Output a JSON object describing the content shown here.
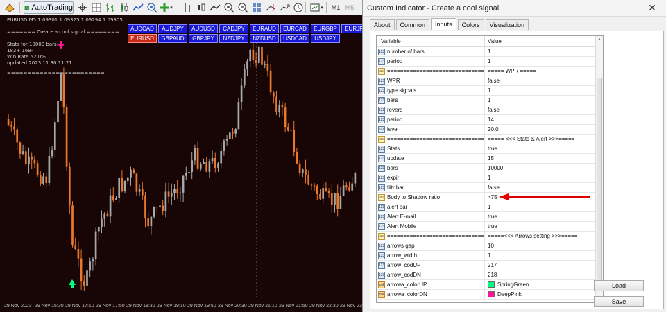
{
  "toolbar": {
    "autotrading_label": "AutoTrading",
    "timeframes": [
      "M1",
      "M5"
    ]
  },
  "chart": {
    "symbol_line": "EURUSD,M5  1.09301 1.09325 1.09294 1.09305",
    "signal_title": "======= Create a cool signal ========",
    "stats_lines": [
      "Stats for 10000 bars:",
      "183+   169-",
      "Win Rate 52.0%",
      "updated 2023.11.30 11:21"
    ],
    "separator_line": "========================",
    "pair_buttons": [
      [
        "AUDCAD",
        "AUDJPY",
        "AUDUSD",
        "CADJPY",
        "EURAUD",
        "EURCAD",
        "EURGBP",
        "EURJPY"
      ],
      [
        "EURUSD",
        "GBPAUD",
        "GBPJPY",
        "NZDJPY",
        "NZDUSD",
        "USDCAD",
        "USDJPY"
      ]
    ],
    "active_pair": "EURUSD",
    "time_labels": [
      "29 Nov 2023",
      "29 Nov 16:30",
      "29 Nov 17:10",
      "29 Nov 17:50",
      "29 Nov 18:30",
      "29 Nov 19:10",
      "29 Nov 19:50",
      "29 Nov 20:30",
      "29 Nov 21:10",
      "29 Nov 21:50",
      "29 Nov 22:30",
      "29 Nov 23:10"
    ],
    "colors": {
      "background": "#180505",
      "bull": "#a8a8a8",
      "bear": "#e8782c",
      "buy_arrow": "#00ff7f",
      "sell_arrow": "#ff1493"
    }
  },
  "dialog": {
    "title": "Custom Indicator - Create a cool signal",
    "close_glyph": "✕",
    "tabs": [
      "About",
      "Common",
      "Inputs",
      "Colors",
      "Visualization"
    ],
    "active_tab": "Inputs",
    "columns": {
      "variable": "Variable",
      "value": "Value"
    },
    "rows": [
      {
        "type": "num",
        "variable": "number of bars",
        "value": "1"
      },
      {
        "type": "num",
        "variable": "period",
        "value": "1"
      },
      {
        "type": "ab",
        "variable": "==================================",
        "value": "===== WPR ====="
      },
      {
        "type": "num",
        "variable": "WPR",
        "value": "false"
      },
      {
        "type": "num",
        "variable": "type signals",
        "value": "1"
      },
      {
        "type": "num",
        "variable": "bars",
        "value": "1"
      },
      {
        "type": "num",
        "variable": "revers",
        "value": "false"
      },
      {
        "type": "num",
        "variable": "period",
        "value": "14"
      },
      {
        "type": "frac",
        "variable": "level",
        "value": "20.0"
      },
      {
        "type": "ab",
        "variable": "==================================",
        "value": "===== <<< Stats & Alert >>>====="
      },
      {
        "type": "num",
        "variable": "Stats",
        "value": "true"
      },
      {
        "type": "num",
        "variable": "update",
        "value": "15"
      },
      {
        "type": "num",
        "variable": "bars",
        "value": "10000"
      },
      {
        "type": "num",
        "variable": "expir",
        "value": "1"
      },
      {
        "type": "num",
        "variable": "filtr bar",
        "value": "false"
      },
      {
        "type": "ab",
        "variable": "Body to Shadow ratio",
        "value": ">75",
        "annotated": true
      },
      {
        "type": "num",
        "variable": "alert bar",
        "value": "1"
      },
      {
        "type": "num",
        "variable": "Alert E-mail",
        "value": "true"
      },
      {
        "type": "num",
        "variable": "Alert Mobile",
        "value": "true"
      },
      {
        "type": "ab",
        "variable": "==================================",
        "value": "=====<<< Arrows setting >>>====="
      },
      {
        "type": "num",
        "variable": "arrows gap",
        "value": "10"
      },
      {
        "type": "num",
        "variable": "arrow_width",
        "value": "1"
      },
      {
        "type": "num",
        "variable": "arrow_codUP",
        "value": "217"
      },
      {
        "type": "num",
        "variable": "arrow_codDN",
        "value": "218"
      },
      {
        "type": "col",
        "variable": "arrowa_colorUP",
        "value": "SpringGreen",
        "swatch": "#00ff7f"
      },
      {
        "type": "col",
        "variable": "arrowa_colorDN",
        "value": "DeepPink",
        "swatch": "#ff1493"
      }
    ],
    "type_icons": {
      "num": "123",
      "frac": "1/2",
      "ab": "ab",
      "col": "col"
    },
    "load_label": "Load",
    "save_label": "Save",
    "annotation_color": "#e00000"
  }
}
